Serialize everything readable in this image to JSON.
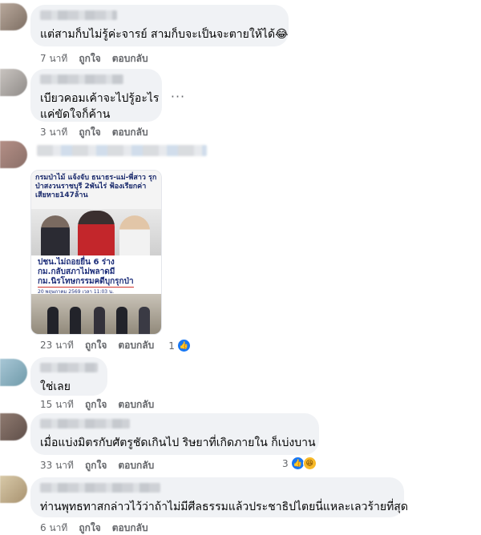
{
  "comments": [
    {
      "text": "แต่สามก็บไม่รู้ค่ะจารย์ สามก็บจะเป็นจะตายให้ได้😂",
      "time": "7 นาที",
      "like": "ถูกใจ",
      "reply": "ตอบกลับ"
    },
    {
      "text_line1": "เบียวคอมเค้าจะไปรู้อะไร",
      "text_line2": "แค่ขัดใจก็ค้าน",
      "time": "3 นาที",
      "like": "ถูกใจ",
      "reply": "ตอบกลับ",
      "more": "···"
    },
    {
      "card": {
        "headline": "กรมป่าไม้ แจ้งจับ ธนาธร-แม่-พี่สาว รุกป่าสงวนราชบุรี 2พันไร่ ฟ้องเรียกค่าเสียหาย147ล้าน",
        "caption_line1": "ปชน.ไม่ถอยยื่น 6 ร่าง",
        "caption_line2": "กม.กลับสภาไม่พลาดมี",
        "caption_line3": "กม.นิรโทษกรรมคดีบุกรุกป่า",
        "date": "20 พฤษภาคม 2569 เวลา 11:03 น."
      },
      "time": "23 นาที",
      "like": "ถูกใจ",
      "reply": "ตอบกลับ",
      "reaction_count": "1",
      "reactions": [
        "like-icon"
      ]
    },
    {
      "text": "ใช่เลย",
      "time": "15 นาที",
      "like": "ถูกใจ",
      "reply": "ตอบกลับ"
    },
    {
      "text": "เมื่อแบ่งมิตรกับศัตรูชัดเกินไป ริษยาที่เกิดภายใน ก็เบ่งบาน",
      "time": "33 นาที",
      "like": "ถูกใจ",
      "reply": "ตอบกลับ",
      "reaction_count": "3",
      "reactions": [
        "like-icon",
        "haha-icon"
      ]
    },
    {
      "text": "ท่านพุทธทาสกล่าวไว้ว่าถ้าไม่มีศีลธรรมแล้วประชาธิปไตยนี่แหละเลวร้ายที่สุด",
      "time": "6 นาที",
      "like": "ถูกใจ",
      "reply": "ตอบกลับ"
    }
  ],
  "colors": {
    "bubble": "#f0f2f5",
    "meta_text": "#65676b",
    "like_blue": "#1877f2",
    "haha_yellow": "#f7b928"
  }
}
